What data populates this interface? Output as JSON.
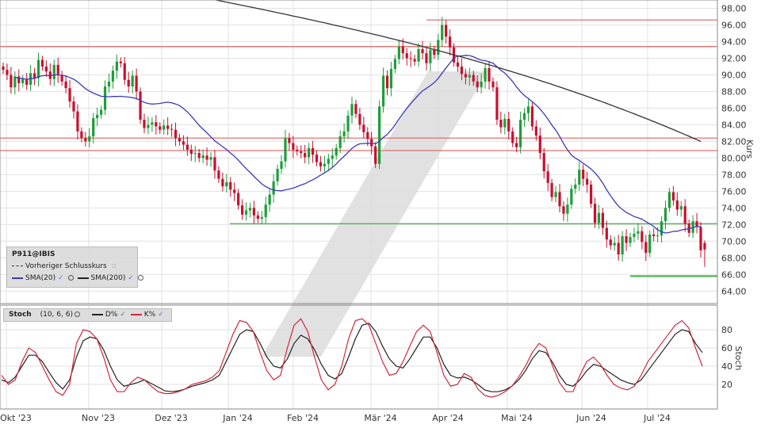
{
  "chart_data": [
    {
      "type": "candlestick",
      "symbol": "P911@IBIS",
      "ylabel": "Kurs",
      "ylim": [
        62.5,
        99.0
      ],
      "yticks": [
        "98.00",
        "96.00",
        "94.00",
        "92.00",
        "90.00",
        "88.00",
        "86.00",
        "84.00",
        "82.00",
        "80.00",
        "78.00",
        "76.00",
        "74.00",
        "72.00",
        "70.00",
        "68.00",
        "66.00",
        "64.00"
      ],
      "x_tick_labels": [
        "Okt '23",
        "Nov '23",
        "Dez '23",
        "Jan '24",
        "Feb '24",
        "Mär '24",
        "Apr '24",
        "Mai '24",
        "Jun '24",
        "Jul '24"
      ],
      "legend": {
        "symbol": "P911@IBIS",
        "prev_close": "Vorheriger Schlusskurs",
        "sma20": "SMA(20)",
        "sma200": "SMA(200)"
      },
      "close_series": [
        90.6,
        90.0,
        88.5,
        89.8,
        89.0,
        89.5,
        88.8,
        90.2,
        89.6,
        91.8,
        91.0,
        90.4,
        89.5,
        91.2,
        90.0,
        89.2,
        88.4,
        86.8,
        85.6,
        83.2,
        82.4,
        82.0,
        82.6,
        84.8,
        85.2,
        85.8,
        88.6,
        89.2,
        90.5,
        91.6,
        91.4,
        89.4,
        88.6,
        89.9,
        88.0,
        84.6,
        83.6,
        84.0,
        84.3,
        83.8,
        83.4,
        83.9,
        83.5,
        83.4,
        82.4,
        82.0,
        81.6,
        81.0,
        80.5,
        80.6,
        80.0,
        80.3,
        79.8,
        80.1,
        78.5,
        77.5,
        76.6,
        77.1,
        76.2,
        75.8,
        74.3,
        73.2,
        73.7,
        74.0,
        73.1,
        72.7,
        72.9,
        74.4,
        75.6,
        77.2,
        78.7,
        79.6,
        82.4,
        81.8,
        81.0,
        80.8,
        80.6,
        80.1,
        81.2,
        80.4,
        79.5,
        79.0,
        79.3,
        79.9,
        80.3,
        81.2,
        82.6,
        83.2,
        85.1,
        86.5,
        85.3,
        84.0,
        83.1,
        82.3,
        81.4,
        79.3,
        86.2,
        89.9,
        88.4,
        90.7,
        91.9,
        93.4,
        92.6,
        92.0,
        91.9,
        91.6,
        93.1,
        92.6,
        91.4,
        93.0,
        92.4,
        94.2,
        96.0,
        94.6,
        93.3,
        91.5,
        91.0,
        90.1,
        89.7,
        90.0,
        89.2,
        88.5,
        89.2,
        90.8,
        89.2,
        88.5,
        84.6,
        83.7,
        84.7,
        83.2,
        81.8,
        81.3,
        84.6,
        85.4,
        86.2,
        83.8,
        82.7,
        80.6,
        78.4,
        77.0,
        75.3,
        75.9,
        74.2,
        73.3,
        74.4,
        76.3,
        76.8,
        78.6,
        77.5,
        76.8,
        74.5,
        72.2,
        73.4,
        71.6,
        70.2,
        69.5,
        69.8,
        68.4,
        70.6,
        69.8,
        70.5,
        70.9,
        71.2,
        69.9,
        68.6,
        70.8,
        70.6,
        70.7,
        72.4,
        74.0,
        75.9,
        74.9,
        73.8,
        74.2,
        72.1,
        71.0,
        72.4,
        71.7,
        68.9
      ],
      "last_candles": [
        {
          "open": 69.8,
          "high": 70.1,
          "low": 66.9,
          "close": 69.0
        }
      ],
      "sma20_visible_range": [
        76.0,
        94.2
      ],
      "sma200_end": 82.0,
      "resistance_levels": [
        96.6,
        93.4,
        82.4,
        80.9
      ],
      "support_levels": [
        72.1,
        65.8
      ]
    },
    {
      "type": "line",
      "title": "Stoch",
      "params": "(10, 6, 6)",
      "ylabel": "Stoch",
      "ylim": [
        0,
        100
      ],
      "yticks": [
        "80",
        "60",
        "40",
        "20"
      ],
      "series": [
        {
          "name": "D%",
          "color": "#222222",
          "values": [
            25,
            22,
            28,
            40,
            52,
            52,
            45,
            33,
            22,
            15,
            25,
            50,
            68,
            72,
            70,
            58,
            40,
            25,
            18,
            20,
            22,
            25,
            21,
            17,
            13,
            12,
            13,
            15,
            18,
            20,
            22,
            25,
            30,
            45,
            60,
            75,
            80,
            78,
            65,
            50,
            40,
            38,
            48,
            65,
            74,
            70,
            58,
            42,
            30,
            26,
            32,
            50,
            70,
            85,
            87,
            78,
            62,
            48,
            40,
            38,
            48,
            60,
            72,
            72,
            60,
            42,
            30,
            27,
            28,
            25,
            20,
            14,
            12,
            12,
            14,
            18,
            25,
            35,
            48,
            57,
            55,
            44,
            30,
            20,
            18,
            25,
            35,
            42,
            40,
            35,
            30,
            25,
            22,
            20,
            25,
            35,
            45,
            55,
            65,
            75,
            80,
            78,
            65,
            55
          ]
        },
        {
          "name": "K%",
          "color": "#d0283c",
          "values": [
            30,
            20,
            25,
            45,
            60,
            55,
            40,
            25,
            12,
            8,
            20,
            65,
            80,
            78,
            70,
            50,
            25,
            12,
            12,
            22,
            28,
            25,
            18,
            12,
            10,
            10,
            12,
            15,
            20,
            22,
            24,
            28,
            35,
            55,
            75,
            90,
            88,
            78,
            55,
            35,
            25,
            30,
            60,
            85,
            92,
            78,
            50,
            25,
            14,
            20,
            40,
            70,
            90,
            92,
            85,
            65,
            45,
            30,
            32,
            45,
            62,
            78,
            85,
            78,
            55,
            30,
            18,
            20,
            32,
            28,
            15,
            8,
            6,
            8,
            12,
            18,
            28,
            40,
            55,
            65,
            60,
            40,
            22,
            12,
            12,
            30,
            45,
            50,
            42,
            30,
            20,
            16,
            14,
            18,
            30,
            45,
            55,
            65,
            75,
            85,
            90,
            82,
            60,
            40
          ]
        }
      ]
    }
  ]
}
